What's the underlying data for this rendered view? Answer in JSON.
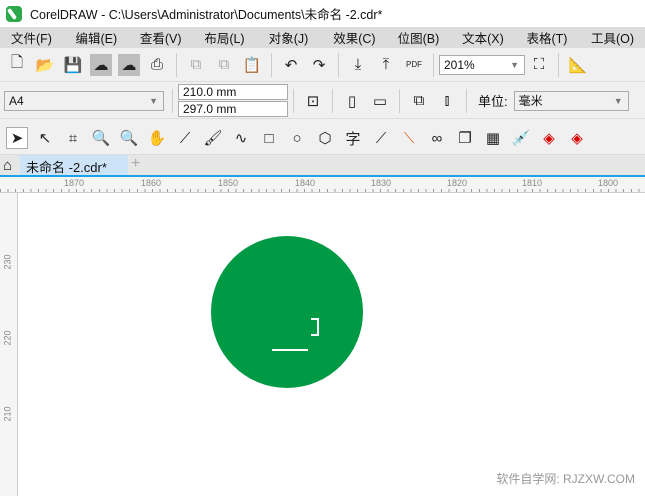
{
  "title": "CorelDRAW - C:\\Users\\Administrator\\Documents\\未命名 -2.cdr*",
  "menu": [
    "文件(F)",
    "编辑(E)",
    "查看(V)",
    "布局(L)",
    "对象(J)",
    "效果(C)",
    "位图(B)",
    "文本(X)",
    "表格(T)",
    "工具(O)"
  ],
  "toolbar": {
    "zoom": "201%",
    "pdf": "PDF"
  },
  "property_bar": {
    "page_size": "A4",
    "width": "210.0 mm",
    "height": "297.0 mm",
    "unit_label": "单位:",
    "unit": "毫米"
  },
  "toolbox": {
    "text_tool": "字"
  },
  "tab": {
    "label": "未命名 -2.cdr*",
    "add": "+"
  },
  "rulers": {
    "h": [
      "1870",
      "1860",
      "1850",
      "1840",
      "1830",
      "1820",
      "1810",
      "1800"
    ],
    "v": [
      "230",
      "220",
      "210"
    ]
  },
  "shape": {
    "color": "#009a44"
  },
  "watermark": "软件自学网: RJZXW.COM"
}
